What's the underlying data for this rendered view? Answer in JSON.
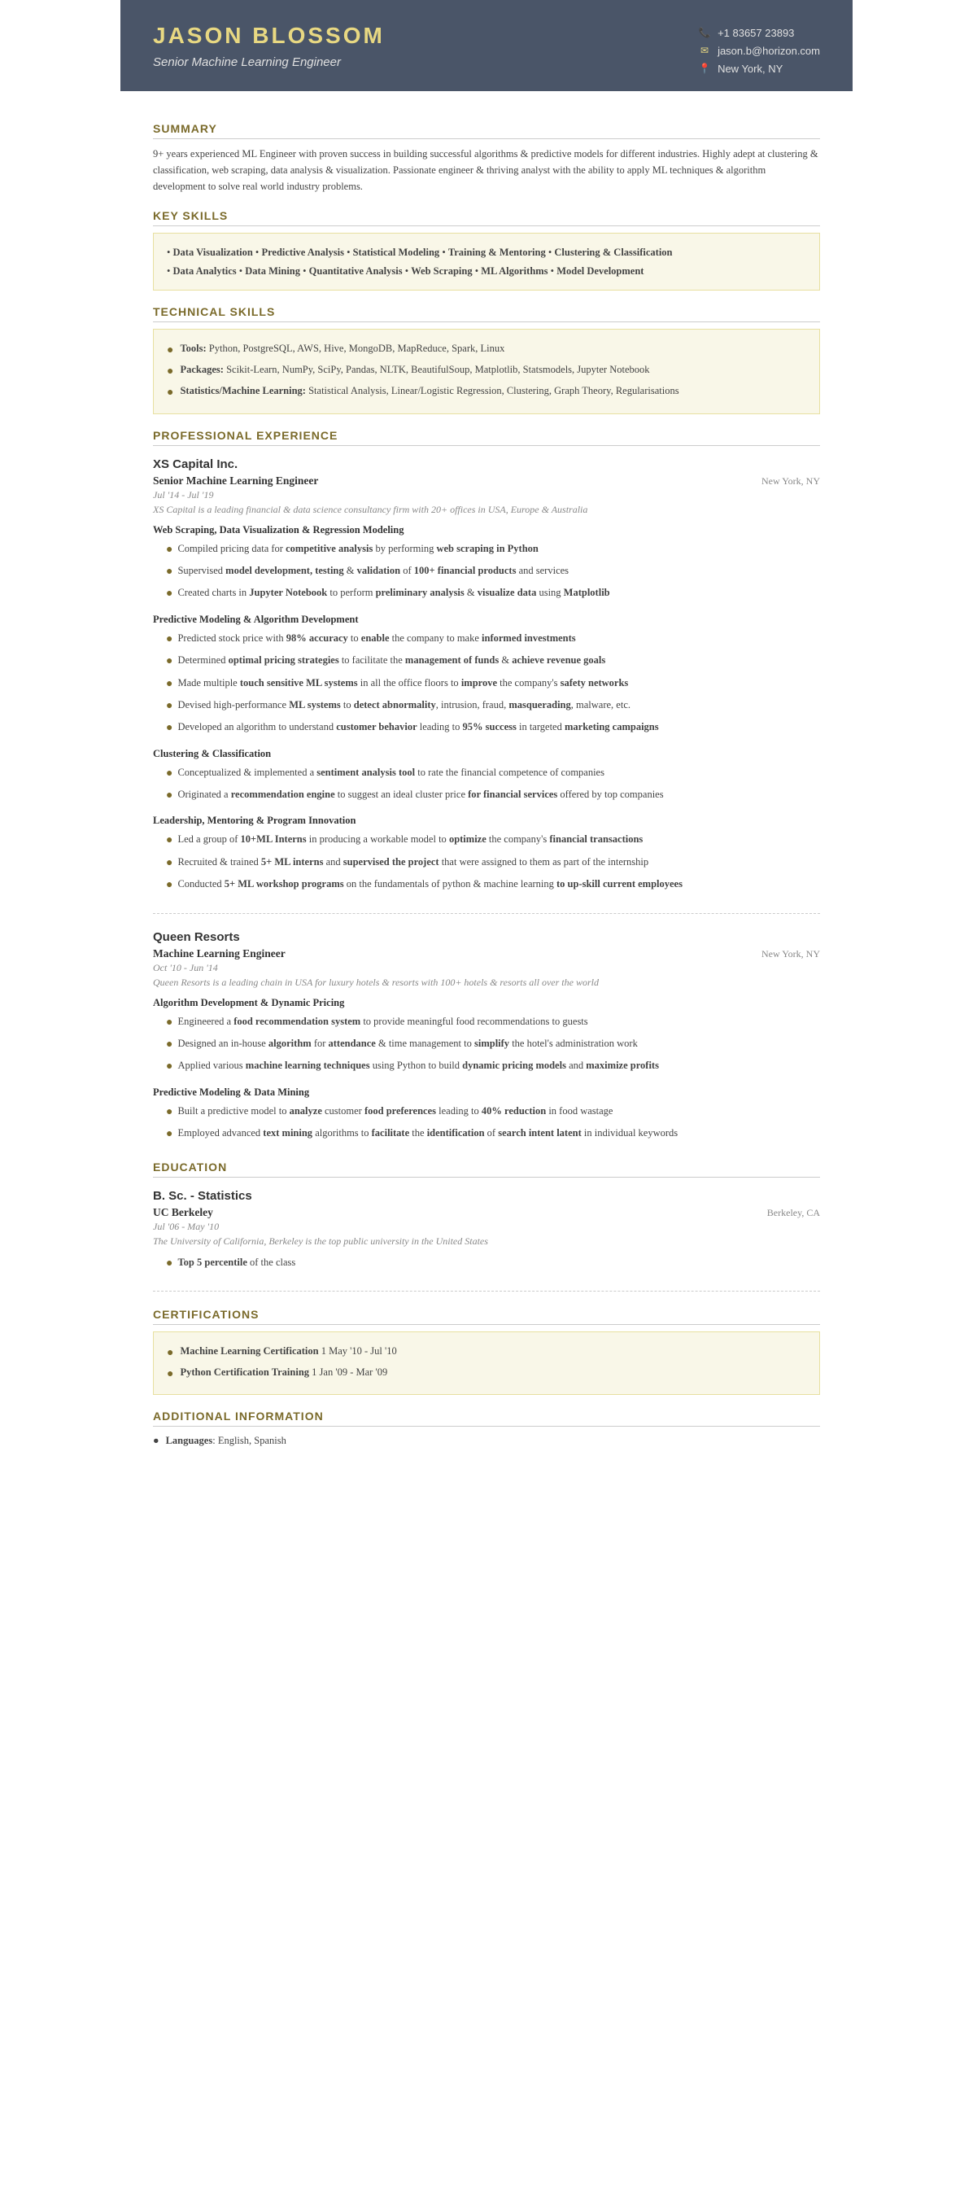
{
  "header": {
    "name": "JASON BLOSSOM",
    "title": "Senior Machine Learning Engineer",
    "phone": "+1 83657 23893",
    "email": "jason.b@horizon.com",
    "location": "New York, NY"
  },
  "summary": {
    "section_label": "SUMMARY",
    "text": "9+ years experienced ML Engineer with proven success in building successful algorithms & predictive models for different industries. Highly adept at clustering & classification, web scraping, data analysis & visualization. Passionate engineer & thriving analyst with the ability to apply ML techniques & algorithm development to solve real world industry problems."
  },
  "key_skills": {
    "section_label": "KEY SKILLS",
    "line1": "• Data Visualization • Predictive Analysis • Statistical Modeling • Training & Mentoring • Clustering & Classification",
    "line2": "• Data Analytics • Data Mining • Quantitative Analysis • Web Scraping • ML Algorithms • Model Development"
  },
  "technical_skills": {
    "section_label": "TECHNICAL SKILLS",
    "items": [
      {
        "label": "Tools:",
        "value": "Python, PostgreSQL, AWS, Hive, MongoDB, MapReduce, Spark, Linux"
      },
      {
        "label": "Packages:",
        "value": "Scikit-Learn, NumPy, SciPy, Pandas, NLTK, BeautifulSoup, Matplotlib, Statsmodels, Jupyter Notebook"
      },
      {
        "label": "Statistics/Machine Learning:",
        "value": "Statistical Analysis, Linear/Logistic Regression, Clustering, Graph Theory, Regularisations"
      }
    ]
  },
  "experience": {
    "section_label": "PROFESSIONAL EXPERIENCE",
    "jobs": [
      {
        "company": "XS Capital Inc.",
        "title": "Senior Machine Learning Engineer",
        "location": "New York, NY",
        "dates": "Jul '14 - Jul '19",
        "description": "XS Capital is a leading financial & data science consultancy firm with 20+ offices in USA, Europe & Australia",
        "sections": [
          {
            "heading": "Web Scraping, Data Visualization & Regression Modeling",
            "bullets": [
              "Compiled pricing data for <b>competitive analysis</b> by performing <b>web scraping in Python</b>",
              "Supervised <b>model development, testing</b> & <b>validation</b> of <b>100+ financial products</b> and services",
              "Created charts in <b>Jupyter Notebook</b> to perform <b>preliminary analysis</b> & <b>visualize data</b> using <b>Matplotlib</b>"
            ]
          },
          {
            "heading": "Predictive Modeling & Algorithm Development",
            "bullets": [
              "Predicted stock price with <b>98% accuracy</b> to <b>enable</b> the company to make <b>informed investments</b>",
              "Determined <b>optimal pricing strategies</b> to facilitate the <b>management of funds</b> & <b>achieve revenue goals</b>",
              "Made multiple <b>touch sensitive ML systems</b> in all the office floors to <b>improve</b> the company's <b>safety networks</b>",
              "Devised high-performance <b>ML systems</b> to <b>detect abnormality</b>, intrusion, fraud, <b>masquerading</b>, malware, etc.",
              "Developed an algorithm to understand <b>customer behavior</b> leading to <b>95% success</b> in targeted <b>marketing campaigns</b>"
            ]
          },
          {
            "heading": "Clustering & Classification",
            "bullets": [
              "Conceptualized & implemented a <b>sentiment analysis tool</b> to rate the financial competence of companies",
              "Originated a <b>recommendation engine</b> to suggest an ideal cluster price <b>for financial services</b> offered by top companies"
            ]
          },
          {
            "heading": "Leadership, Mentoring & Program Innovation",
            "bullets": [
              "Led a group of <b>10+ML Interns</b> in producing a workable model to <b>optimize</b> the company's <b>financial transactions</b>",
              "Recruited & trained <b>5+ ML interns</b> and <b>supervised the project</b> that were assigned to them as part of the internship",
              "Conducted <b>5+ ML workshop programs</b> on the fundamentals of python & machine learning <b>to up-skill current employees</b>"
            ]
          }
        ]
      },
      {
        "company": "Queen Resorts",
        "title": "Machine Learning Engineer",
        "location": "New York, NY",
        "dates": "Oct '10 - Jun '14",
        "description": "Queen Resorts is a leading chain in USA for luxury hotels & resorts with 100+ hotels & resorts all over the world",
        "sections": [
          {
            "heading": "Algorithm Development & Dynamic Pricing",
            "bullets": [
              "Engineered a <b>food recommendation system</b> to provide meaningful food recommendations to guests",
              "Designed an in-house <b>algorithm</b> for <b>attendance</b> & time management to <b>simplify</b> the hotel's administration work",
              "Applied various <b>machine learning techniques</b> using Python to build <b>dynamic pricing models</b> and <b>maximize profits</b>"
            ]
          },
          {
            "heading": "Predictive Modeling & Data Mining",
            "bullets": [
              "Built a predictive model to <b>analyze</b> customer <b>food preferences</b> leading to <b>40% reduction</b> in food wastage",
              "Employed advanced <b>text mining</b> algorithms to <b>facilitate</b> the <b>identification</b> of <b>search intent latent</b> in individual keywords"
            ]
          }
        ]
      }
    ]
  },
  "education": {
    "section_label": "EDUCATION",
    "items": [
      {
        "degree": "B. Sc. - Statistics",
        "institution": "UC Berkeley",
        "location": "Berkeley, CA",
        "dates": "Jul '06 - May '10",
        "description": "The University of California, Berkeley is the top public university in the United States",
        "bullets": [
          "<b>Top 5 percentile</b> of the class"
        ]
      }
    ]
  },
  "certifications": {
    "section_label": "CERTIFICATIONS",
    "items": [
      {
        "title": "Machine Learning Certification",
        "dates": "1 May '10 - Jul '10"
      },
      {
        "title": "Python Certification Training",
        "dates": "1 Jan '09 - Mar '09"
      }
    ]
  },
  "additional": {
    "section_label": "ADDITIONAL INFORMATION",
    "items": [
      {
        "label": "Languages",
        "value": "English, Spanish"
      }
    ]
  }
}
